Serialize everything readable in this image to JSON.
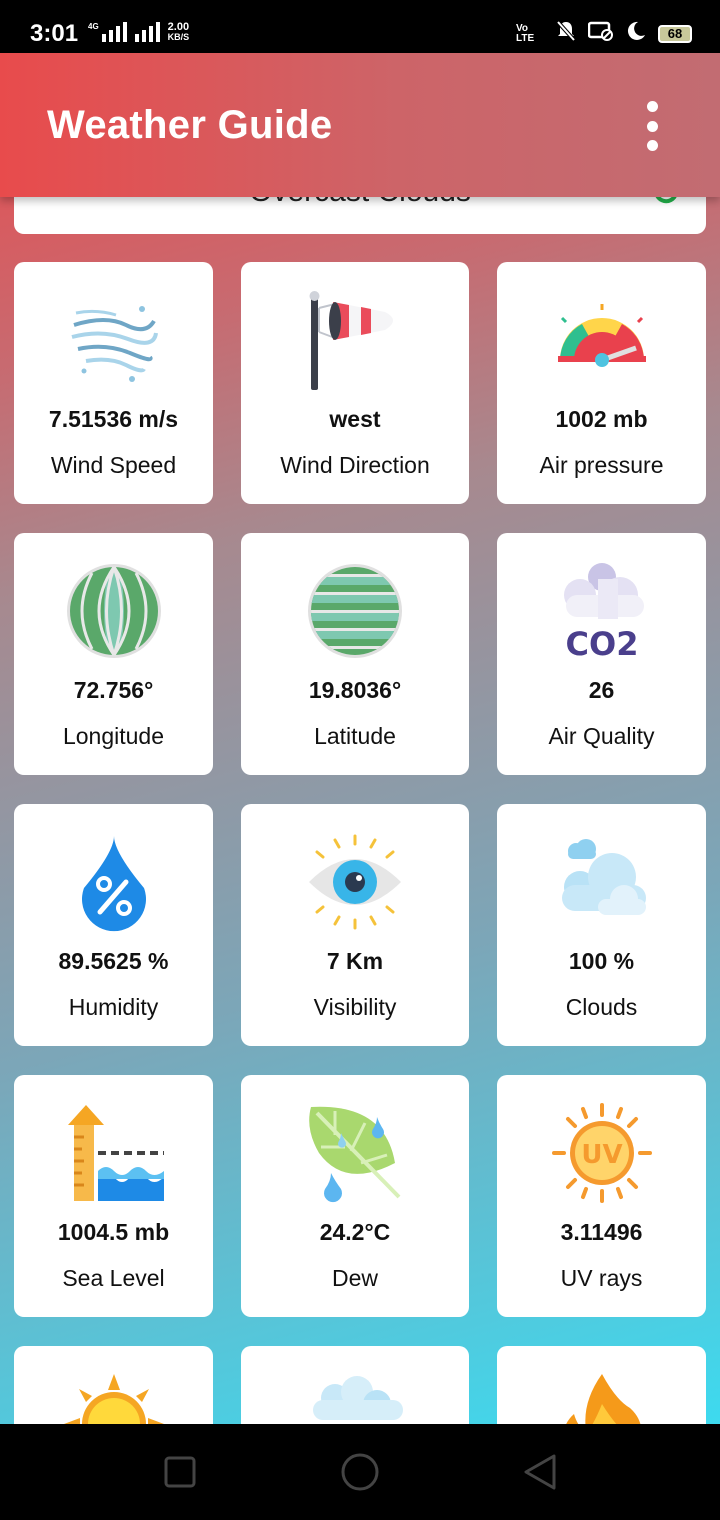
{
  "status_bar": {
    "time": "3:01",
    "network_type": "4G",
    "net_speed_value": "2.00",
    "net_speed_unit": "KB/S",
    "volte": "Vo LTE",
    "battery": "68"
  },
  "toolbar": {
    "title": "Weather Guide"
  },
  "weather": {
    "description": "Overcast Clouds"
  },
  "cards": [
    {
      "value": "7.51536 m/s",
      "label": "Wind Speed",
      "icon": "wind-icon"
    },
    {
      "value": "west",
      "label": "Wind Direction",
      "icon": "windsock-icon"
    },
    {
      "value": "1002 mb",
      "label": "Air pressure",
      "icon": "gauge-icon"
    },
    {
      "value": "72.756°",
      "label": "Longitude",
      "icon": "longitude-globe-icon"
    },
    {
      "value": "19.8036°",
      "label": "Latitude",
      "icon": "latitude-globe-icon"
    },
    {
      "value": "26",
      "label": "Air Quality",
      "icon": "co2-cloud-icon",
      "icon_text": "CO2"
    },
    {
      "value": "89.5625 %",
      "label": "Humidity",
      "icon": "humidity-drop-icon"
    },
    {
      "value": "7 Km",
      "label": "Visibility",
      "icon": "eye-icon"
    },
    {
      "value": "100 %",
      "label": "Clouds",
      "icon": "clouds-icon"
    },
    {
      "value": "1004.5 mb",
      "label": "Sea Level",
      "icon": "sea-level-icon"
    },
    {
      "value": "24.2°C",
      "label": "Dew",
      "icon": "dew-leaf-icon"
    },
    {
      "value": "3.11496",
      "label": "UV rays",
      "icon": "uv-sun-icon",
      "icon_text": "UV"
    },
    {
      "value": "",
      "label": "",
      "icon": "sun-icon"
    },
    {
      "value": "",
      "label": "",
      "icon": "snow-cloud-icon"
    },
    {
      "value": "",
      "label": "",
      "icon": "fire-icon"
    }
  ],
  "colors": {
    "toolbar_start": "#e84b4c",
    "toolbar_end": "#c26c72",
    "background_bottom": "#3ddaef",
    "card": "#ffffff"
  }
}
